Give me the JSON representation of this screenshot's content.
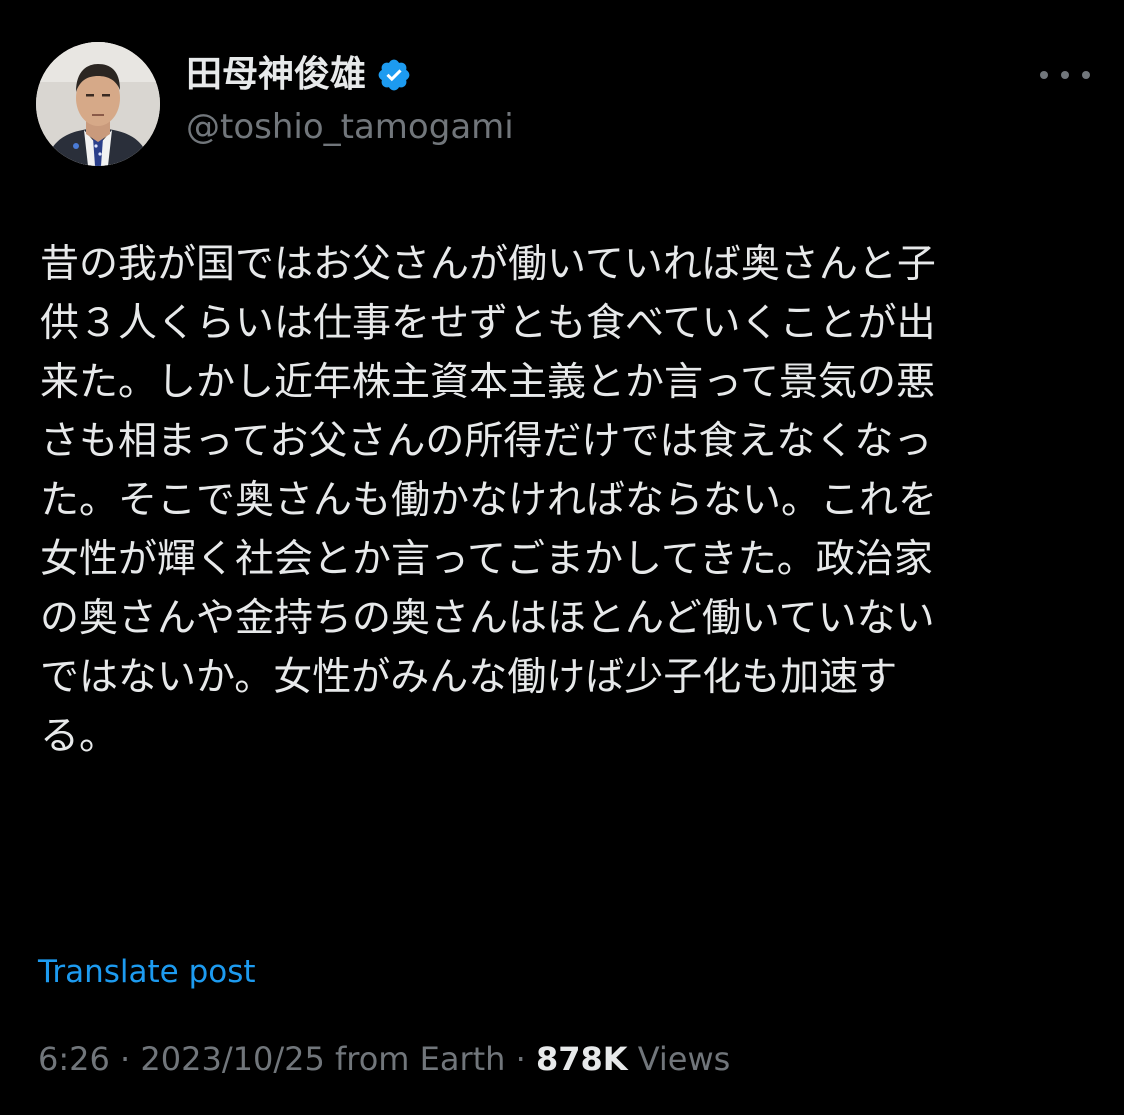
{
  "author": {
    "display_name": "田母神俊雄",
    "handle": "@toshio_tamogami",
    "verified": true,
    "avatar_icon": "user-avatar"
  },
  "tweet": {
    "lines": [
      "昔の我が国ではお父さんが働いていれば奥さんと子",
      "供３人くらいは仕事をせずとも食べていくことが出",
      "来た。しかし近年株主資本主義とか言って景気の悪",
      "さも相まってお父さんの所得だけでは食えなくなっ",
      "た。そこで奥さんも働かなければならない。これを",
      "女性が輝く社会とか言ってごまかしてきた。政治家",
      "の奥さんや金持ちの奥さんはほとんど働いていない",
      "ではないか。女性がみんな働けば少子化も加速す",
      "る。"
    ]
  },
  "translate_label": "Translate post",
  "meta": {
    "time": "6:26",
    "separator": " · ",
    "date": "2023/10/25",
    "source": " from Earth",
    "views_count": "878K",
    "views_label": " Views"
  },
  "colors": {
    "background": "#000000",
    "text": "#e7e9ea",
    "secondary": "#71767b",
    "accent": "#1d9bf0"
  },
  "icons": {
    "verified": "verified-badge-icon",
    "more": "more-options-icon"
  }
}
